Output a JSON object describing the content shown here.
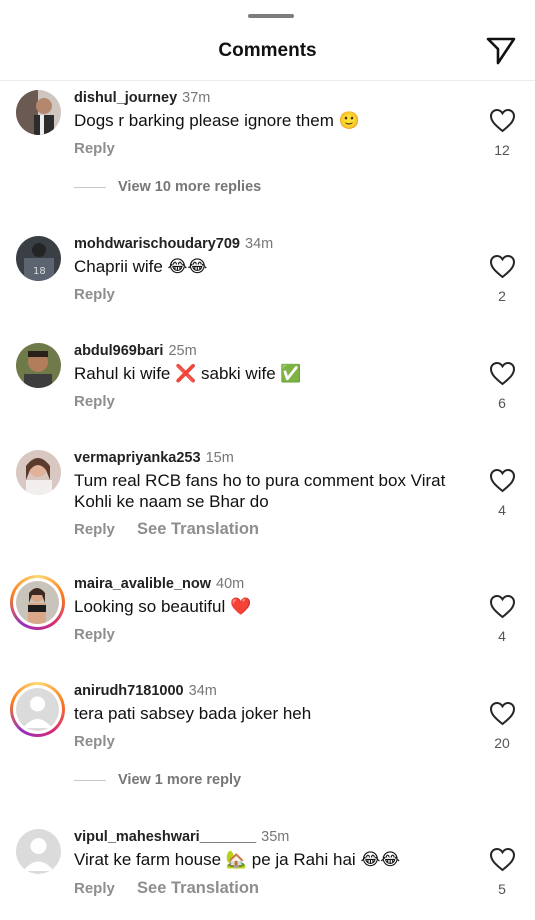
{
  "header": {
    "title": "Comments",
    "share_icon": "paper-plane-icon"
  },
  "reply_label": "Reply",
  "translation_label": "See Translation",
  "comments": [
    {
      "username": "dishul_journey",
      "time": "37m",
      "text": "Dogs r barking please ignore them",
      "emoji": "🙂",
      "likes": "12",
      "more_replies": "View 10 more replies"
    },
    {
      "username": "mohdwarischoudary709",
      "time": "34m",
      "text": "Chaprii wife",
      "emoji": "😂😂",
      "likes": "2"
    },
    {
      "username": "abdul969bari",
      "time": "25m",
      "text": "Rahul ki wife",
      "emoji": "❌",
      "text2": "sabki wife",
      "emoji2": "✅",
      "likes": "6"
    },
    {
      "username": "vermapriyanka253",
      "time": "15m",
      "text": "Tum real RCB fans ho to pura comment box Virat Kohli ke naam se Bhar do",
      "likes": "4"
    },
    {
      "username": "maira_avalible_now",
      "time": "40m",
      "text": "Looking so beautiful",
      "emoji": "❤️",
      "likes": "4"
    },
    {
      "username": "anirudh7181000",
      "time": "34m",
      "text": "tera pati sabsey bada joker heh",
      "likes": "20",
      "more_replies": "View 1 more reply"
    },
    {
      "username": "vipul_maheshwari_______",
      "time": "35m",
      "text": "Virat ke farm house",
      "emoji": "🏡",
      "text2": "pe ja Rahi hai",
      "emoji2": "😂😂",
      "likes": "5"
    }
  ],
  "colors": {
    "heart_stroke": "#262626",
    "secondary_text": "#8e8e8e",
    "story_ring": "#d62976"
  }
}
